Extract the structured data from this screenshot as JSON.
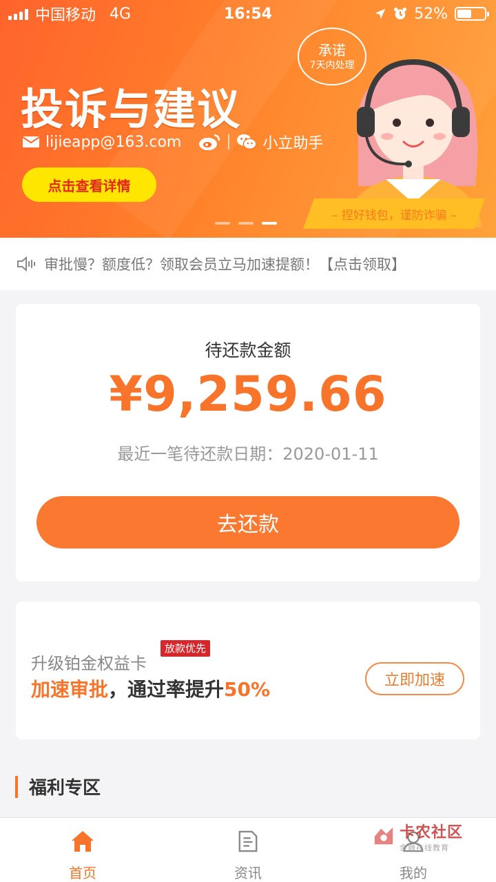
{
  "status_bar": {
    "carrier": "中国移动",
    "network": "4G",
    "time": "16:54",
    "battery": "52%",
    "battery_level": 0.52
  },
  "banner": {
    "title": "投诉与建议",
    "email": "lijieapp@163.com",
    "wechat_name": "小立助手",
    "promise_line1": "承诺",
    "promise_line2": "7天内处理",
    "button_label": "点击查看详情",
    "slogan": "– 捏好钱包，谨防诈骗 –",
    "active_slide": 3,
    "slide_count": 3
  },
  "notice": {
    "text": "审批慢？额度低？领取会员立马加速提额！【点击领取】"
  },
  "repayment": {
    "label": "待还款金额",
    "amount": "¥9,259.66",
    "date_text": "最近一笔待还款日期：2020-01-11",
    "button_label": "去还款"
  },
  "upgrade": {
    "title": "升级铂金权益卡",
    "tag": "放款优先",
    "desc_accent": "加速审批",
    "desc_middle": "，通过率提升",
    "desc_percent": "50%",
    "button_label": "立即加速"
  },
  "welfare": {
    "title": "福利专区"
  },
  "tabbar": {
    "items": [
      {
        "label": "首页",
        "icon": "home-icon",
        "active": true
      },
      {
        "label": "资讯",
        "icon": "news-icon",
        "active": false
      },
      {
        "label": "我的",
        "icon": "profile-icon",
        "active": false
      }
    ]
  },
  "watermark": {
    "main": "卡农社区",
    "sub": "金融在线教育"
  },
  "colors": {
    "accent": "#f7742a",
    "banner_start": "#ff5a1f",
    "banner_end": "#ffa23a",
    "button_yellow": "#ffe600",
    "tag_red": "#d8262b"
  }
}
